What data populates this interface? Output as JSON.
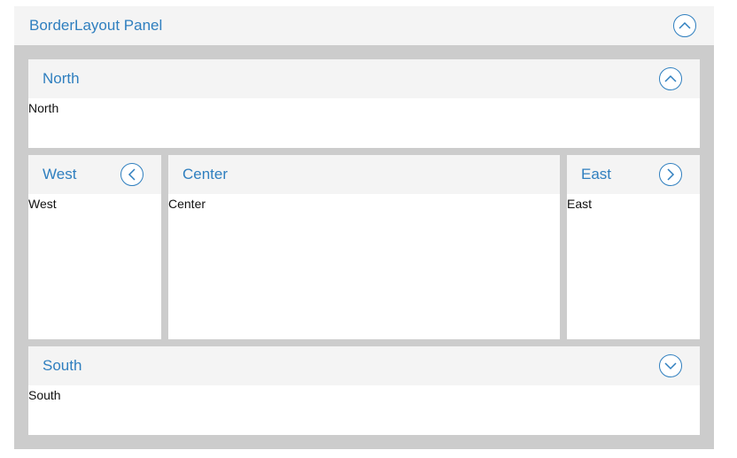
{
  "panel": {
    "title": "BorderLayout Panel",
    "collapse_icon": "chevron-up-icon"
  },
  "regions": {
    "north": {
      "title": "North",
      "body": "North",
      "tool_icon": "chevron-up-icon"
    },
    "west": {
      "title": "West",
      "body": "West",
      "tool_icon": "chevron-left-icon"
    },
    "center": {
      "title": "Center",
      "body": "Center"
    },
    "east": {
      "title": "East",
      "body": "East",
      "tool_icon": "chevron-right-icon"
    },
    "south": {
      "title": "South",
      "body": "South",
      "tool_icon": "chevron-down-icon"
    }
  },
  "colors": {
    "accent": "#2f7fbf",
    "header_bg": "#f4f4f4",
    "frame_bg": "#cccccc",
    "body_bg": "#ffffff"
  }
}
